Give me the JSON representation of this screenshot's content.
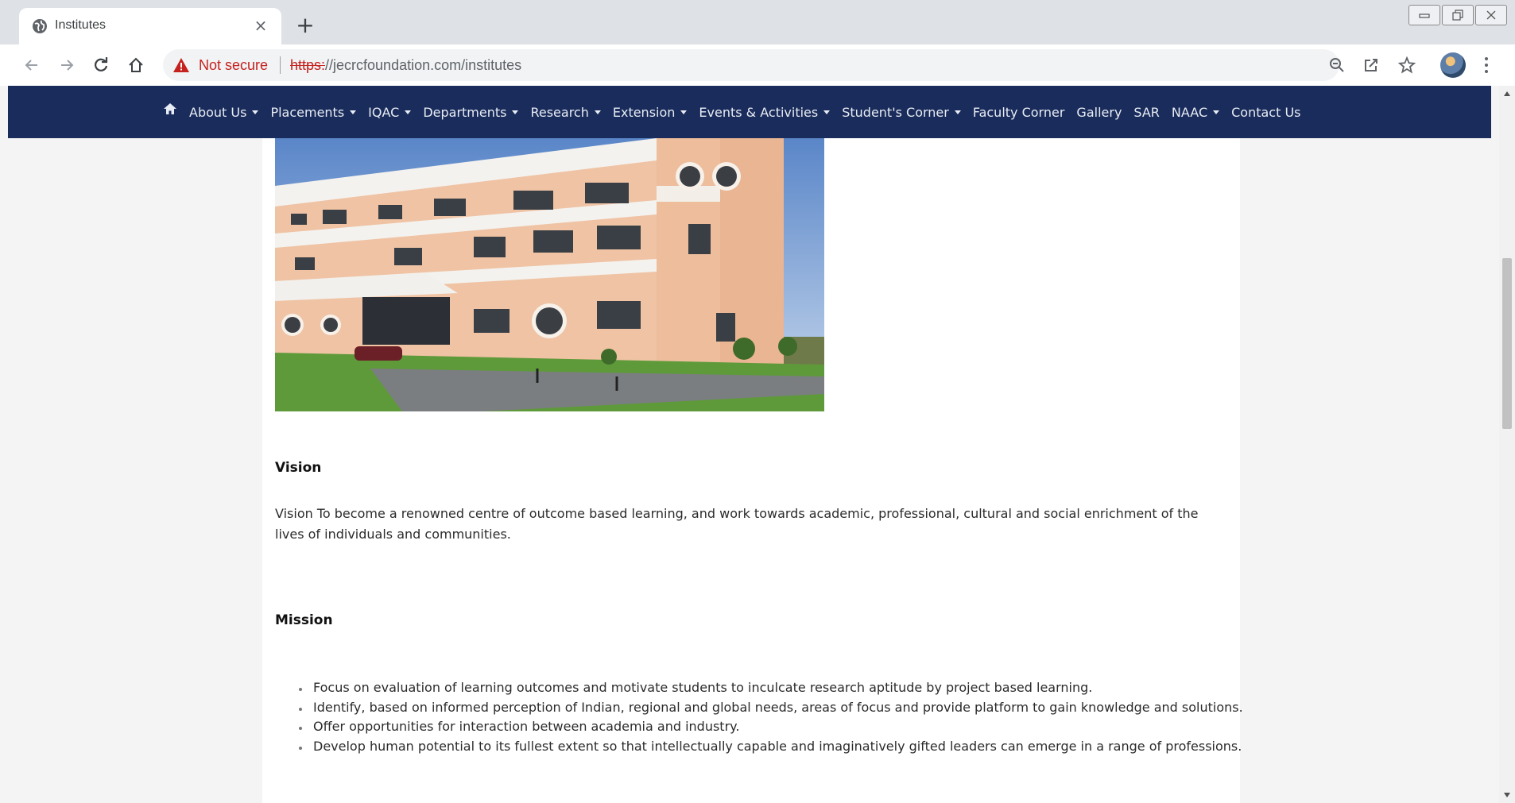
{
  "browser": {
    "tab_title": "Institutes",
    "tab_close": "×",
    "new_tab": "+",
    "security_label": "Not secure",
    "url_scheme": "https:",
    "url_rest": "//jecrcfoundation.com/institutes"
  },
  "nav": {
    "items": [
      {
        "label": "About Us",
        "dropdown": true
      },
      {
        "label": "Placements",
        "dropdown": true
      },
      {
        "label": "IQAC",
        "dropdown": true
      },
      {
        "label": "Departments",
        "dropdown": true
      },
      {
        "label": "Research",
        "dropdown": true
      },
      {
        "label": "Extension",
        "dropdown": true
      },
      {
        "label": "Events & Activities",
        "dropdown": true
      },
      {
        "label": "Student's Corner",
        "dropdown": true
      },
      {
        "label": "Faculty Corner",
        "dropdown": false
      },
      {
        "label": "Gallery",
        "dropdown": false
      },
      {
        "label": "SAR",
        "dropdown": false
      },
      {
        "label": "NAAC",
        "dropdown": true
      },
      {
        "label": "Contact Us",
        "dropdown": false
      }
    ]
  },
  "content": {
    "vision_heading": "Vision",
    "vision_text": "Vision To become a renowned centre of outcome based learning, and work towards academic, professional, cultural and social enrichment of the lives of individuals and communities.",
    "mission_heading": "Mission",
    "mission_items": [
      "Focus on evaluation of learning outcomes and motivate students to inculcate research aptitude by project based learning.",
      "Identify, based on informed perception of Indian, regional and global needs, areas of focus and provide platform to gain knowledge and solutions.",
      "Offer opportunities for interaction between academia and industry.",
      "Develop human potential to its fullest extent so that intellectually capable and imaginatively gifted leaders can emerge in a range of professions."
    ]
  },
  "colors": {
    "navbar": "#1a2c5b",
    "not_secure": "#c5221f",
    "page_bg": "#f4f4f4"
  }
}
